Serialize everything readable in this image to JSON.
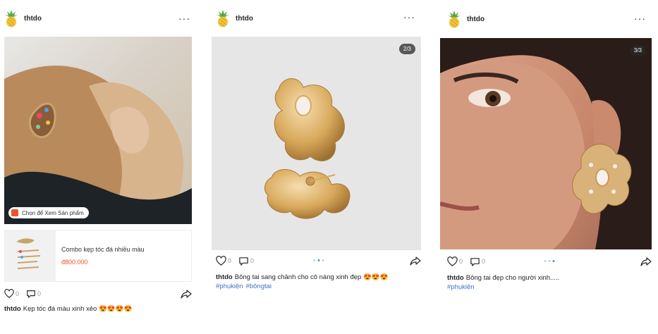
{
  "posts": [
    {
      "username": "thtdo",
      "more": "···",
      "tag_label": "Chọn để Xem Sản phẩm",
      "product": {
        "name": "Combo kẹp tóc đá nhiều màu",
        "price": "đ800.000"
      },
      "likes": "0",
      "comments": "0",
      "caption_user": "thtdo",
      "caption_text": "Kẹp tóc đá màu xinh xẻo 😍😍😍😍"
    },
    {
      "username": "thtdo",
      "more": "···",
      "counter": "2/3",
      "likes": "0",
      "comments": "0",
      "caption_user": "thtdo",
      "caption_text": "Bông tai sang chảnh cho cô nàng xinh đẹp 😍😍😍",
      "hashtags": [
        "#phụkiện",
        "#bôngtai"
      ]
    },
    {
      "username": "thtdo",
      "more": "···",
      "counter": "3/3",
      "likes": "0",
      "comments": "0",
      "caption_user": "thtdo",
      "caption_text": "Bông tai đẹp cho người xinh.....",
      "hashtags": [
        "#phụkiện"
      ]
    }
  ],
  "colors": {
    "accent": "#e8542d",
    "link": "#3f72c0",
    "active_dot": "#3897f0"
  },
  "icons": [
    "pineapple-avatar-icon",
    "more-icon",
    "heart-icon",
    "comment-icon",
    "share-icon",
    "shopping-bag-icon"
  ]
}
